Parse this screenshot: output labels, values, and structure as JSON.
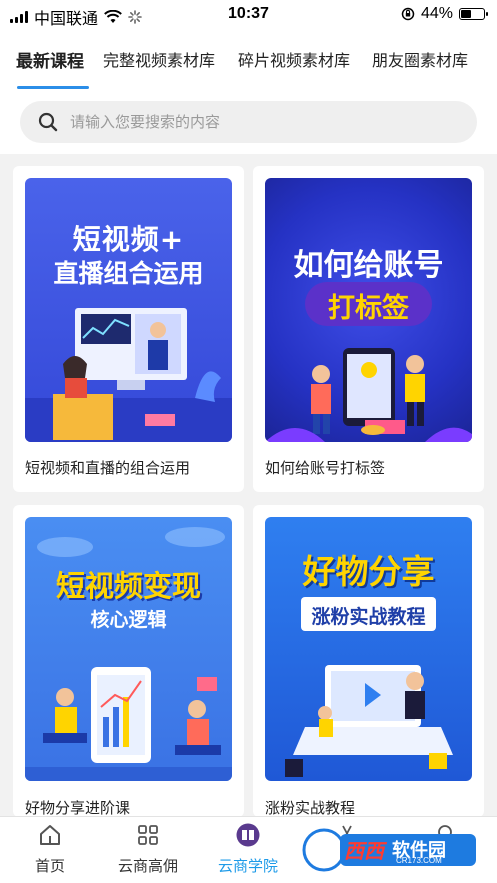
{
  "status_bar": {
    "carrier": "中国联通",
    "time": "10:37",
    "battery_text": "44%",
    "battery_level": 0.44
  },
  "tabs": [
    {
      "label": "最新课程",
      "active": true
    },
    {
      "label": "完整视频素材库",
      "active": false
    },
    {
      "label": "碎片视频素材库",
      "active": false
    },
    {
      "label": "朋友圈素材库",
      "active": false
    }
  ],
  "search": {
    "placeholder": "请输入您要搜索的内容",
    "icon": "search-icon"
  },
  "courses": [
    {
      "title": "短视频和直播的组合运用",
      "poster_lines": [
        "短视频+",
        "直播组合运用"
      ],
      "bg": "#3d55e0"
    },
    {
      "title": "如何给账号打标签",
      "poster_lines": [
        "如何给账号",
        "打标签"
      ],
      "bg": "#2f3fd0"
    },
    {
      "title": "好物分享进阶课",
      "poster_lines": [
        "短视频变现",
        "核心逻辑"
      ],
      "bg": "#3f7ee8"
    },
    {
      "title": "涨粉实战教程",
      "poster_lines": [
        "好物分享",
        "涨粉实战教程"
      ],
      "bg": "#2c6fe0"
    }
  ],
  "bottom_nav": [
    {
      "label": "首页",
      "icon": "home-icon",
      "active": false
    },
    {
      "label": "云商高佣",
      "icon": "grid-icon",
      "active": false
    },
    {
      "label": "云商学院",
      "icon": "academy-icon",
      "active": true
    },
    {
      "label": "",
      "icon": "scissors-icon",
      "active": false
    },
    {
      "label": "",
      "icon": "profile-icon",
      "active": false
    }
  ],
  "watermark": {
    "brand": "西西",
    "text": "软件园",
    "domain": "CR173.COM"
  },
  "colors": {
    "accent": "#1e9be8",
    "tab_indicator": "#2b8ee8",
    "poster_yellow": "#ffd400"
  }
}
